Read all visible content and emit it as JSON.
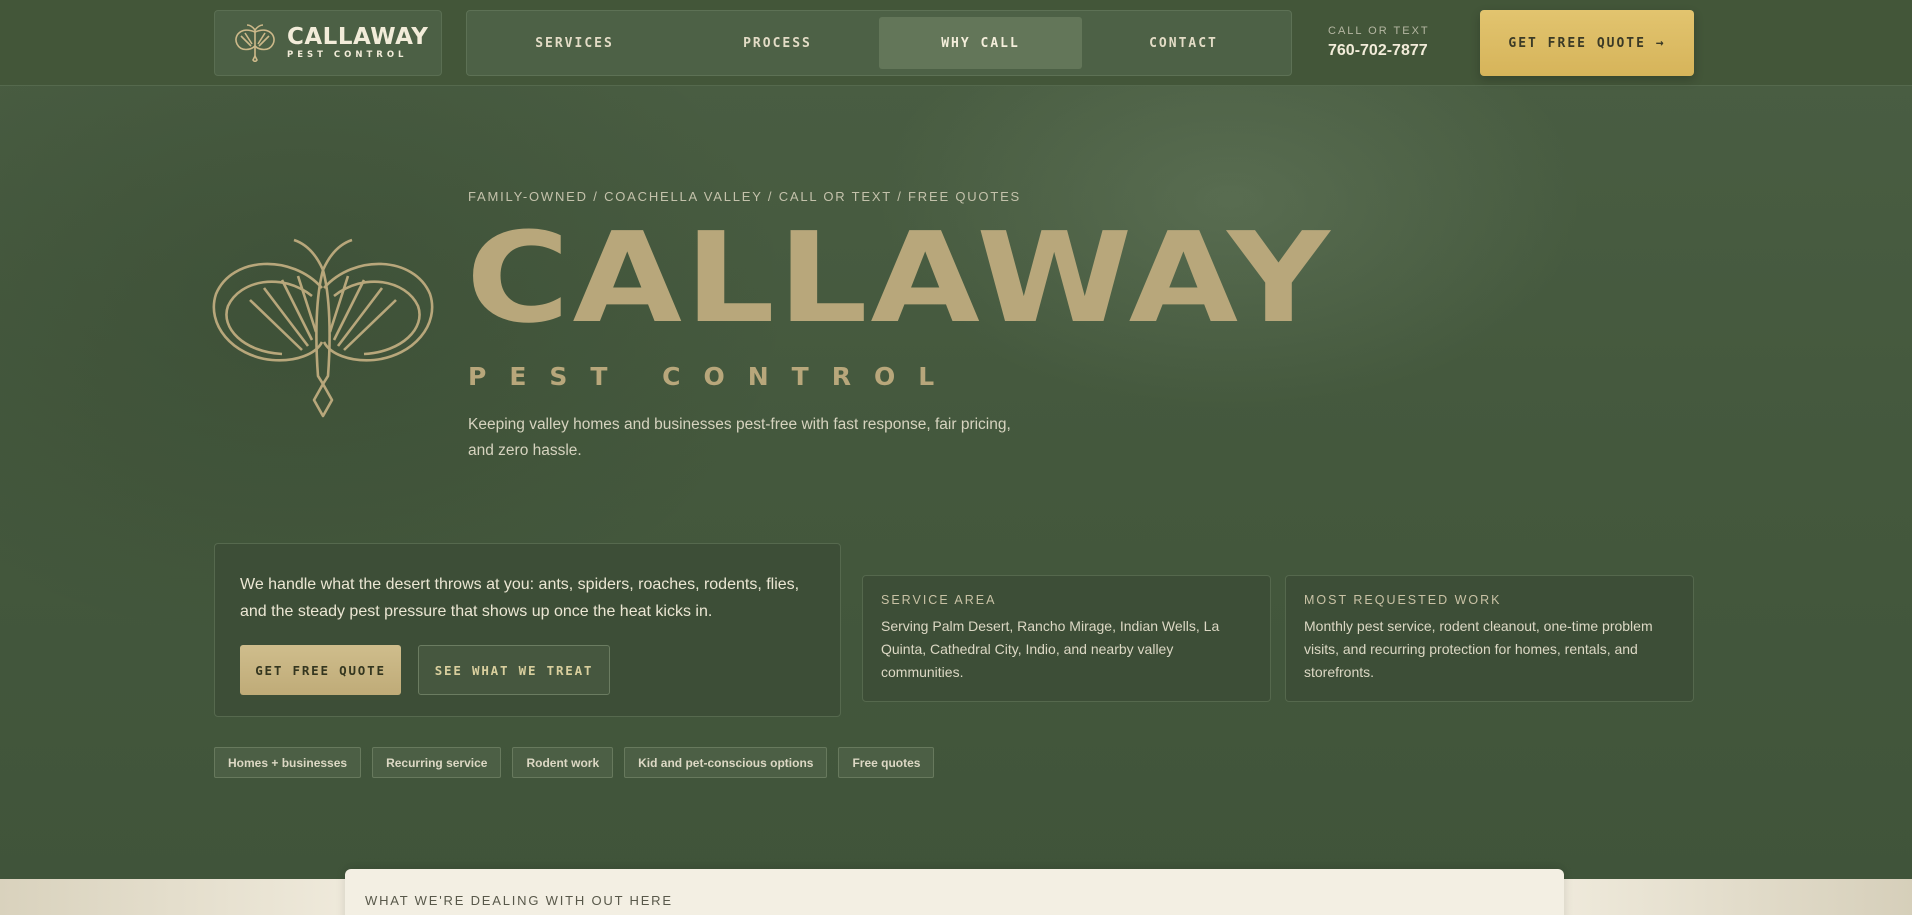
{
  "header": {
    "logo": {
      "name": "CALLAWAY",
      "tagline": "PEST CONTROL"
    },
    "nav": [
      {
        "label": "SERVICES",
        "active": false
      },
      {
        "label": "PROCESS",
        "active": false
      },
      {
        "label": "WHY CALL",
        "active": true
      },
      {
        "label": "CONTACT",
        "active": false
      }
    ],
    "call": {
      "label": "CALL OR TEXT",
      "number": "760-702-7877"
    },
    "quote_button": "GET FREE QUOTE →"
  },
  "hero": {
    "eyebrow": "FAMILY-OWNED / COACHELLA VALLEY / CALL OR TEXT / FREE QUOTES",
    "title": "CALLAWAY",
    "subtitle": "PEST CONTROL",
    "description": "Keeping valley homes and businesses pest-free with fast response, fair pricing, and zero hassle."
  },
  "intro_card": {
    "text": "We handle what the desert throws at you: ants, spiders, roaches, rodents, flies, and the steady pest pressure that shows up once the heat kicks in.",
    "primary_button": "GET FREE QUOTE",
    "secondary_button": "SEE WHAT WE TREAT"
  },
  "info_cards": [
    {
      "title": "SERVICE AREA",
      "body": "Serving Palm Desert, Rancho Mirage, Indian Wells, La Quinta, Cathedral City, Indio, and nearby valley communities."
    },
    {
      "title": "MOST REQUESTED WORK",
      "body": "Monthly pest service, rodent cleanout, one-time problem visits, and recurring protection for homes, rentals, and storefronts."
    }
  ],
  "chips": [
    "Homes + businesses",
    "Recurring service",
    "Rodent work",
    "Kid and pet-conscious options",
    "Free quotes"
  ],
  "next_section": {
    "title": "WHAT WE'RE DEALING WITH OUT HERE"
  },
  "colors": {
    "accent_gold": "#d9b95f",
    "title_tan": "#b8a77b",
    "background_green": "#44583d"
  }
}
